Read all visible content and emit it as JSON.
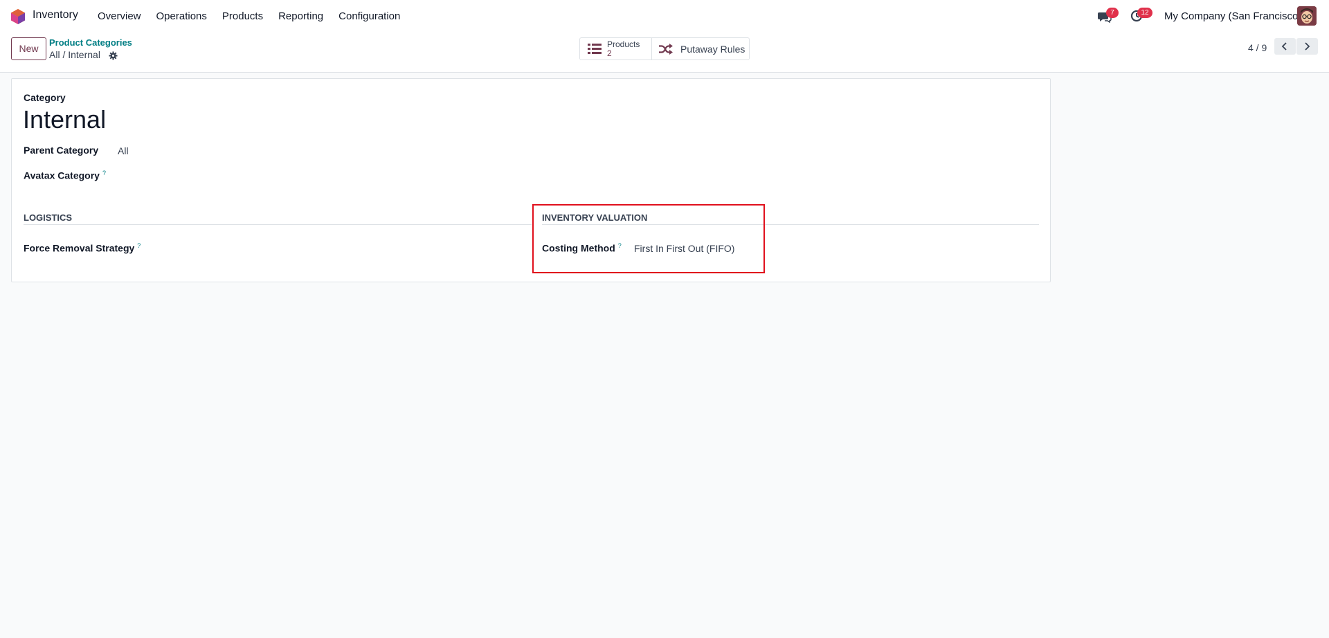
{
  "navbar": {
    "app_name": "Inventory",
    "menu": [
      {
        "label": "Overview"
      },
      {
        "label": "Operations"
      },
      {
        "label": "Products"
      },
      {
        "label": "Reporting"
      },
      {
        "label": "Configuration"
      }
    ],
    "messages_badge": "7",
    "activities_badge": "12",
    "company": "My Company (San Francisco)"
  },
  "control_panel": {
    "new_label": "New",
    "breadcrumb_parent": "Product Categories",
    "breadcrumb_current": "All / Internal",
    "smart_buttons": {
      "products_label": "Products",
      "products_count": "2",
      "putaway_label": "Putaway Rules"
    },
    "pager": "4 / 9"
  },
  "form": {
    "category_label": "Category",
    "name": "Internal",
    "parent_category_label": "Parent Category",
    "parent_category_value": "All",
    "avatax_category_label": "Avatax Category",
    "logistics_title": "LOGISTICS",
    "force_removal_label": "Force Removal Strategy",
    "valuation_title": "INVENTORY VALUATION",
    "costing_method_label": "Costing Method",
    "costing_method_value": "First In First Out (FIFO)",
    "help_mark": "?"
  },
  "colors": {
    "brand": "#71394f",
    "link": "#017e84",
    "badge": "#e0314b",
    "highlight": "#e0101c"
  }
}
